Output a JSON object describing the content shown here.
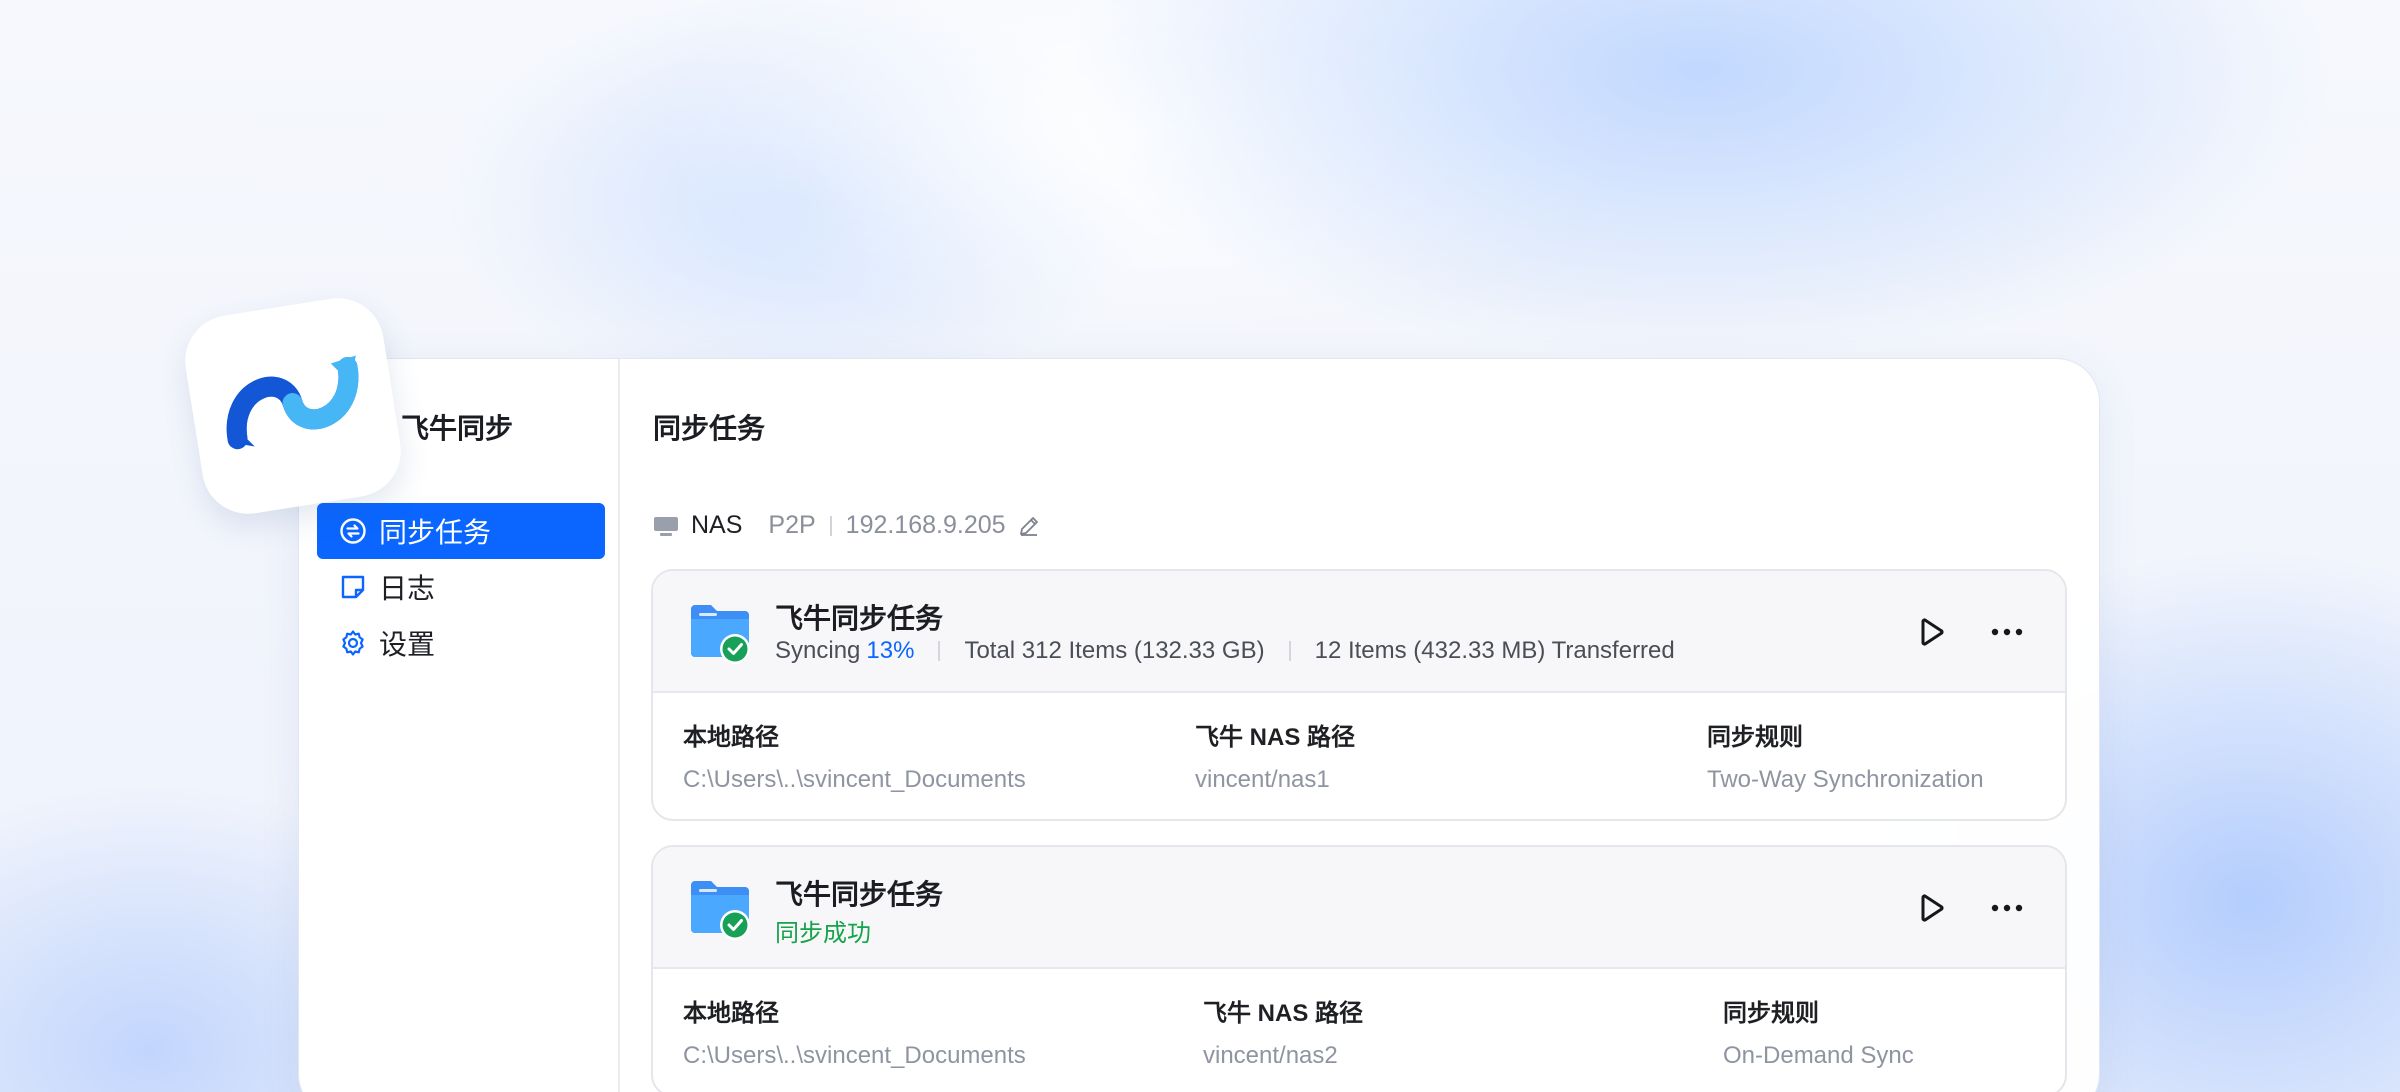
{
  "app": {
    "name": "飞牛同步"
  },
  "sidebar": {
    "items": [
      {
        "label": "同步任务",
        "icon": "sync-task-icon",
        "active": true
      },
      {
        "label": "日志",
        "icon": "log-note-icon",
        "active": false
      },
      {
        "label": "设置",
        "icon": "gear-icon",
        "active": false
      }
    ]
  },
  "main": {
    "title": "同步任务",
    "device": {
      "name": "NAS",
      "mode": "P2P",
      "ip": "192.168.9.205"
    },
    "tasks": [
      {
        "title": "飞牛同步任务",
        "status_label": "Syncing",
        "progress": "13%",
        "total": "Total 312 Items (132.33 GB)",
        "transferred": "12 Items (432.33 MB) Transferred",
        "fields": [
          {
            "label": "本地路径",
            "value": "C:\\Users\\..\\svincent_Documents"
          },
          {
            "label": "飞牛 NAS 路径",
            "value": "vincent/nas1"
          },
          {
            "label": "同步规则",
            "value": "Two-Way Synchronization"
          }
        ]
      },
      {
        "title": "飞牛同步任务",
        "status_label": "同步成功",
        "fields": [
          {
            "label": "本地路径",
            "value": "C:\\Users\\..\\svincent_Documents"
          },
          {
            "label": "飞牛 NAS 路径",
            "value": "vincent/nas2"
          },
          {
            "label": "同步规则",
            "value": "On-Demand Sync"
          }
        ]
      }
    ]
  },
  "colors": {
    "accent": "#0a66ff",
    "success": "#16a34a",
    "muted": "#8e94a0"
  }
}
